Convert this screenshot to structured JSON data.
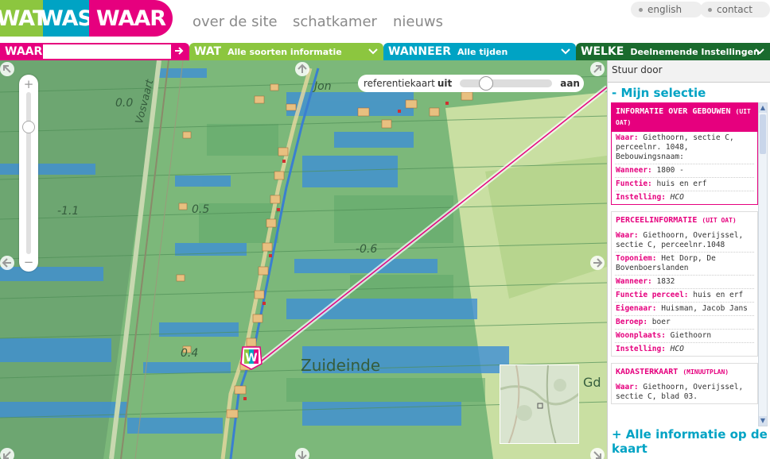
{
  "logo": {
    "part1": "WAT",
    "part2": "WAS",
    "part3": "WAAR"
  },
  "nav": {
    "over": "over de site",
    "schatkamer": "schatkamer",
    "nieuws": "nieuws"
  },
  "util": {
    "english": "english",
    "contact": "contact"
  },
  "filters": {
    "waar": {
      "label": "WAAR",
      "placeholder": ""
    },
    "wat": {
      "label": "WAT",
      "value": "Alle soorten informatie"
    },
    "wanneer": {
      "label": "WANNEER",
      "value": "Alle tijden"
    },
    "welke": {
      "label": "WELKE",
      "value": "Deelnemende Instellingen"
    }
  },
  "map": {
    "referentie_label": "referentiekaart",
    "uit": "uit",
    "aan": "aan",
    "place_label": "Zuideinde",
    "gd": "Gd",
    "vosvaart": "Vosvaart",
    "depth_labels": [
      "0.0",
      "-1.1",
      "0.5",
      "-0.6",
      "0.4"
    ],
    "jonk": "Jon"
  },
  "panel": {
    "stuur_door": "Stuur door",
    "mijn_selectie": "- Mijn selectie",
    "alle_informatie": "+ Alle informatie op de kaart",
    "cards": [
      {
        "title": "INFORMATIE OVER GEBOUWEN",
        "source": "(UIT OAT)",
        "selected": true,
        "rows": [
          {
            "k": "Waar:",
            "v": "Giethoorn, sectie C, perceelnr. 1048, Bebouwingsnaam:"
          },
          {
            "k": "Wanneer:",
            "v": "1800 -"
          },
          {
            "k": "Functie:",
            "v": "huis en erf"
          },
          {
            "k": "Instelling:",
            "v": "HCO",
            "italic": true
          }
        ]
      },
      {
        "title": "PERCEELINFORMATIE",
        "source": "(UIT OAT)",
        "selected": false,
        "rows": [
          {
            "k": "Waar:",
            "v": "Giethoorn, Overijssel, sectie C, perceelnr.1048"
          },
          {
            "k": "Toponiem:",
            "v": "Het Dorp, De Bovenboerslanden"
          },
          {
            "k": "Wanneer:",
            "v": "1832"
          },
          {
            "k": "Functie perceel:",
            "v": "huis en erf"
          },
          {
            "k": "Eigenaar:",
            "v": "Huisman, Jacob Jans"
          },
          {
            "k": "Beroep:",
            "v": "boer"
          },
          {
            "k": "Woonplaats:",
            "v": "Giethoorn"
          },
          {
            "k": "Instelling:",
            "v": "HCO",
            "italic": true
          }
        ]
      },
      {
        "title": "KADASTERKAART",
        "source": "(MINUUTPLAN)",
        "selected": false,
        "rows": [
          {
            "k": "Waar:",
            "v": "Giethoorn, Overijssel, sectie C, blad 03."
          }
        ]
      }
    ]
  },
  "colors": {
    "pink": "#e6007e",
    "green": "#8cc63f",
    "blue": "#00a3c4",
    "darkgreen": "#1a6b2e"
  }
}
